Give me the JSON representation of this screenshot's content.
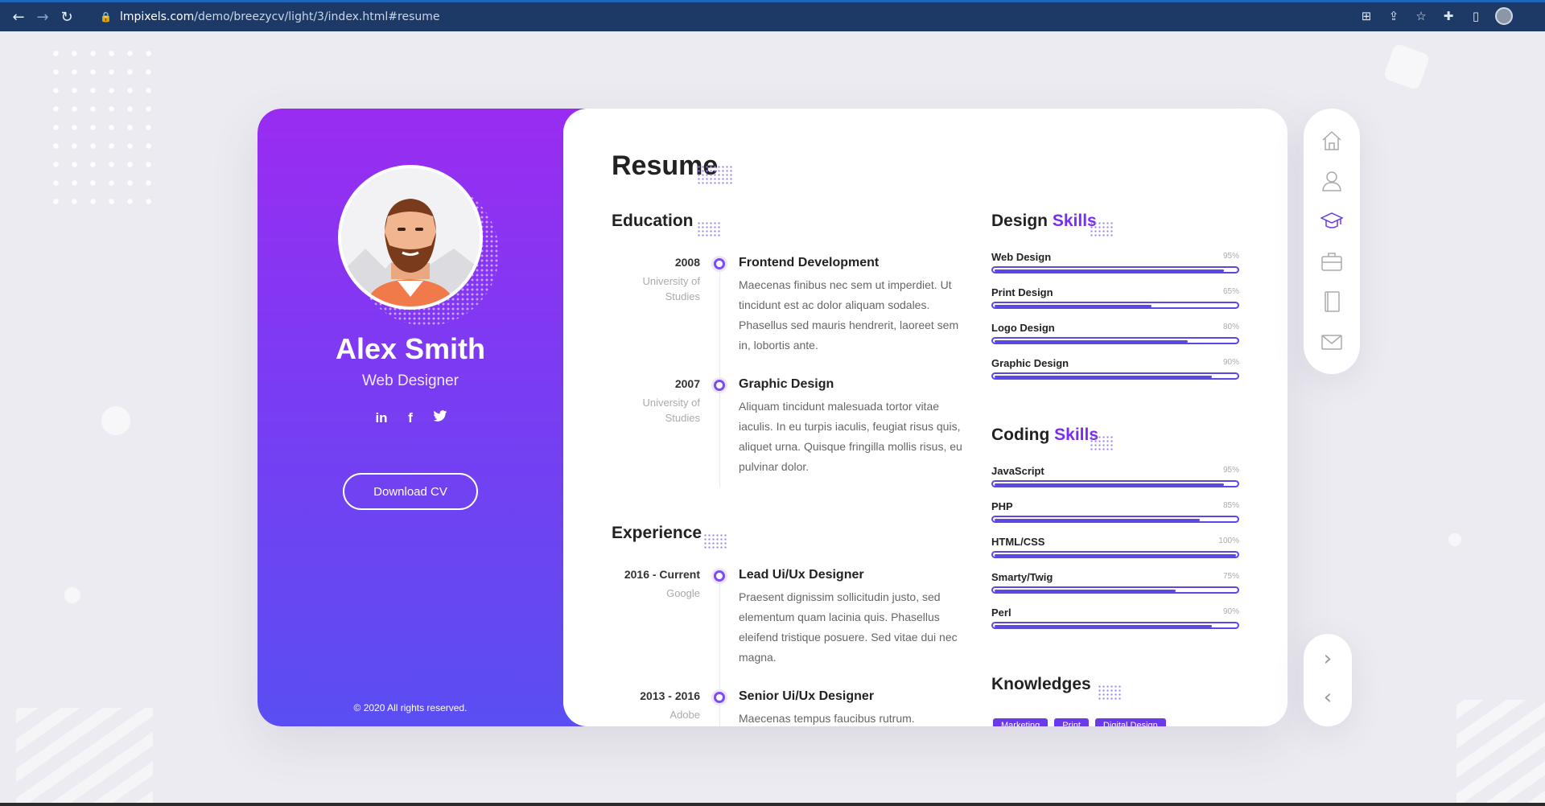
{
  "browser": {
    "url_host": "lmpixels.com",
    "url_path": "/demo/breezycv/light/3/index.html#resume"
  },
  "profile": {
    "name": "Alex Smith",
    "role": "Web Designer",
    "socials": [
      "in",
      "f",
      "t"
    ],
    "download_label": "Download CV",
    "copyright": "© 2020 All rights reserved."
  },
  "resume": {
    "title": "Resume",
    "education_title": "Education",
    "education": [
      {
        "year": "2008",
        "place": "University of Studies",
        "heading": "Frontend Development",
        "text": "Maecenas finibus nec sem ut imperdiet. Ut tincidunt est ac dolor aliquam sodales. Phasellus sed mauris hendrerit, laoreet sem in, lobortis ante."
      },
      {
        "year": "2007",
        "place": "University of Studies",
        "heading": "Graphic Design",
        "text": "Aliquam tincidunt malesuada tortor vitae iaculis. In eu turpis iaculis, feugiat risus quis, aliquet urna. Quisque fringilla mollis risus, eu pulvinar dolor."
      }
    ],
    "experience_title": "Experience",
    "experience": [
      {
        "year": "2016 - Current",
        "place": "Google",
        "heading": "Lead Ui/Ux Designer",
        "text": "Praesent dignissim sollicitudin justo, sed elementum quam lacinia quis. Phasellus eleifend tristique posuere. Sed vitae dui nec magna."
      },
      {
        "year": "2013 - 2016",
        "place": "Adobe",
        "heading": "Senior Ui/Ux Designer",
        "text": "Maecenas tempus faucibus rutrum."
      }
    ],
    "design_skills_word1": "Design",
    "design_skills_word2": "Skills",
    "design_skills": [
      {
        "name": "Web Design",
        "pct": "95%",
        "value": 95
      },
      {
        "name": "Print Design",
        "pct": "65%",
        "value": 65
      },
      {
        "name": "Logo Design",
        "pct": "80%",
        "value": 80
      },
      {
        "name": "Graphic Design",
        "pct": "90%",
        "value": 90
      }
    ],
    "coding_skills_word1": "Coding",
    "coding_skills_word2": "Skills",
    "coding_skills": [
      {
        "name": "JavaScript",
        "pct": "95%",
        "value": 95
      },
      {
        "name": "PHP",
        "pct": "85%",
        "value": 85
      },
      {
        "name": "HTML/CSS",
        "pct": "100%",
        "value": 100
      },
      {
        "name": "Smarty/Twig",
        "pct": "75%",
        "value": 75
      },
      {
        "name": "Perl",
        "pct": "90%",
        "value": 90
      }
    ],
    "knowledges_title": "Knowledges",
    "knowledges": [
      "Marketing",
      "Print",
      "Digital Design"
    ]
  },
  "side_nav": {
    "items": [
      "home-icon",
      "user-icon",
      "graduation-cap-icon",
      "briefcase-icon",
      "book-icon",
      "envelope-icon"
    ],
    "active": "graduation-cap-icon"
  },
  "colors": {
    "accent": "#7b2cf0",
    "bar": "#5b46e6",
    "gradient_top": "#9a2cf2",
    "gradient_bottom": "#5a4ef2"
  }
}
